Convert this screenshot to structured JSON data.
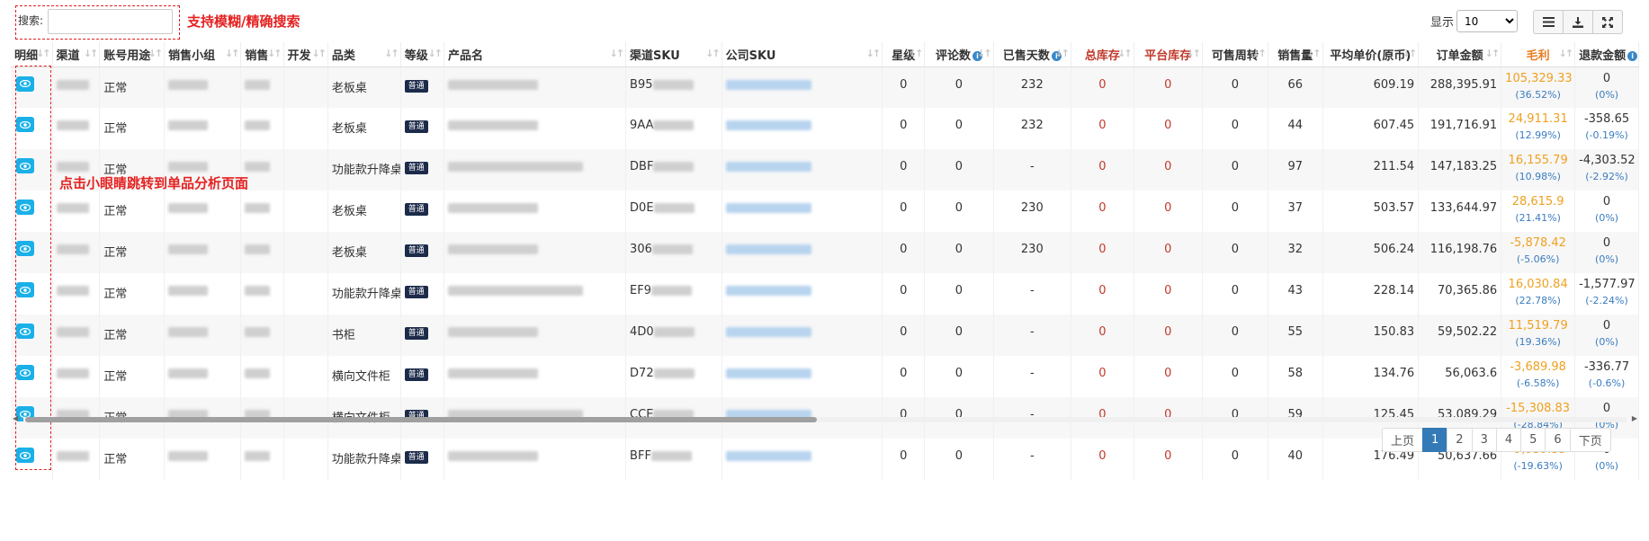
{
  "search": {
    "label": "搜索:",
    "value": "",
    "annotation": "支持模糊/精确搜索"
  },
  "eye_annotation": "点击小眼睛跳转到单品分析页面",
  "display": {
    "label": "显示",
    "page_size": "10"
  },
  "toolbar": {
    "icons": [
      "list-icon",
      "download-icon",
      "fullscreen-icon"
    ]
  },
  "columns": [
    "明细",
    "渠道",
    "账号用途",
    "销售小组",
    "销售",
    "开发",
    "品类",
    "等级",
    "产品名",
    "渠道SKU",
    "公司SKU",
    "星级",
    "评论数",
    "已售天数",
    "总库存",
    "平台库存",
    "可售周转",
    "销售量",
    "平均单价(原币)",
    "订单金额",
    "毛利",
    "退款金额"
  ],
  "rows": [
    {
      "purpose": "正常",
      "category": "老板桌",
      "grade": "普通",
      "sku_prefix": "B95",
      "stars": "0",
      "reviews": "0",
      "days": "232",
      "total_stock": "0",
      "platform_stock": "0",
      "turnover": "0",
      "qty": "66",
      "avg_price": "609.19",
      "amount": "288,395.91",
      "profit": "105,329.33",
      "profit_pct": "(36.52%)",
      "refund": "0",
      "refund_pct": "(0%)"
    },
    {
      "purpose": "正常",
      "category": "老板桌",
      "grade": "普通",
      "sku_prefix": "9AA",
      "stars": "0",
      "reviews": "0",
      "days": "232",
      "total_stock": "0",
      "platform_stock": "0",
      "turnover": "0",
      "qty": "44",
      "avg_price": "607.45",
      "amount": "191,716.91",
      "profit": "24,911.31",
      "profit_pct": "(12.99%)",
      "refund": "-358.65",
      "refund_pct": "(-0.19%)"
    },
    {
      "purpose": "正常",
      "category": "功能款升降桌",
      "grade": "普通",
      "sku_prefix": "DBF",
      "stars": "0",
      "reviews": "0",
      "days": "-",
      "total_stock": "0",
      "platform_stock": "0",
      "turnover": "0",
      "qty": "97",
      "avg_price": "211.54",
      "amount": "147,183.25",
      "profit": "16,155.79",
      "profit_pct": "(10.98%)",
      "refund": "-4,303.52",
      "refund_pct": "(-2.92%)"
    },
    {
      "purpose": "正常",
      "category": "老板桌",
      "grade": "普通",
      "sku_prefix": "D0E",
      "stars": "0",
      "reviews": "0",
      "days": "230",
      "total_stock": "0",
      "platform_stock": "0",
      "turnover": "0",
      "qty": "37",
      "avg_price": "503.57",
      "amount": "133,644.97",
      "profit": "28,615.9",
      "profit_pct": "(21.41%)",
      "refund": "0",
      "refund_pct": "(0%)"
    },
    {
      "purpose": "正常",
      "category": "老板桌",
      "grade": "普通",
      "sku_prefix": "306",
      "stars": "0",
      "reviews": "0",
      "days": "230",
      "total_stock": "0",
      "platform_stock": "0",
      "turnover": "0",
      "qty": "32",
      "avg_price": "506.24",
      "amount": "116,198.76",
      "profit": "-5,878.42",
      "profit_pct": "(-5.06%)",
      "refund": "0",
      "refund_pct": "(0%)"
    },
    {
      "purpose": "正常",
      "category": "功能款升降桌",
      "grade": "普通",
      "sku_prefix": "EF9",
      "stars": "0",
      "reviews": "0",
      "days": "-",
      "total_stock": "0",
      "platform_stock": "0",
      "turnover": "0",
      "qty": "43",
      "avg_price": "228.14",
      "amount": "70,365.86",
      "profit": "16,030.84",
      "profit_pct": "(22.78%)",
      "refund": "-1,577.97",
      "refund_pct": "(-2.24%)"
    },
    {
      "purpose": "正常",
      "category": "书柜",
      "grade": "普通",
      "sku_prefix": "4D0",
      "stars": "0",
      "reviews": "0",
      "days": "-",
      "total_stock": "0",
      "platform_stock": "0",
      "turnover": "0",
      "qty": "55",
      "avg_price": "150.83",
      "amount": "59,502.22",
      "profit": "11,519.79",
      "profit_pct": "(19.36%)",
      "refund": "0",
      "refund_pct": "(0%)"
    },
    {
      "purpose": "正常",
      "category": "横向文件柜",
      "grade": "普通",
      "sku_prefix": "D72",
      "stars": "0",
      "reviews": "0",
      "days": "-",
      "total_stock": "0",
      "platform_stock": "0",
      "turnover": "0",
      "qty": "58",
      "avg_price": "134.76",
      "amount": "56,063.6",
      "profit": "-3,689.98",
      "profit_pct": "(-6.58%)",
      "refund": "-336.77",
      "refund_pct": "(-0.6%)"
    },
    {
      "purpose": "正常",
      "category": "横向文件柜",
      "grade": "普通",
      "sku_prefix": "CCE",
      "stars": "0",
      "reviews": "0",
      "days": "-",
      "total_stock": "0",
      "platform_stock": "0",
      "turnover": "0",
      "qty": "59",
      "avg_price": "125.45",
      "amount": "53,089.29",
      "profit": "-15,308.83",
      "profit_pct": "(-28.84%)",
      "refund": "0",
      "refund_pct": "(0%)"
    },
    {
      "purpose": "正常",
      "category": "功能款升降桌",
      "grade": "普通",
      "sku_prefix": "BFF",
      "stars": "0",
      "reviews": "0",
      "days": "-",
      "total_stock": "0",
      "platform_stock": "0",
      "turnover": "0",
      "qty": "40",
      "avg_price": "176.49",
      "amount": "50,637.66",
      "profit": "-9,939.35",
      "profit_pct": "(-19.63%)",
      "refund": "0",
      "refund_pct": "(0%)"
    }
  ],
  "pagination": {
    "prev": "上页",
    "pages": [
      "1",
      "2",
      "3",
      "4",
      "5",
      "6"
    ],
    "active": "1",
    "next": "下页"
  },
  "colors": {
    "annotation": "#e52222",
    "eye_button": "#1ab0e8",
    "profit": "#f0a020",
    "stock_red": "#c0392b",
    "pct_blue": "#3a7cc0",
    "active_page": "#337ab7"
  }
}
